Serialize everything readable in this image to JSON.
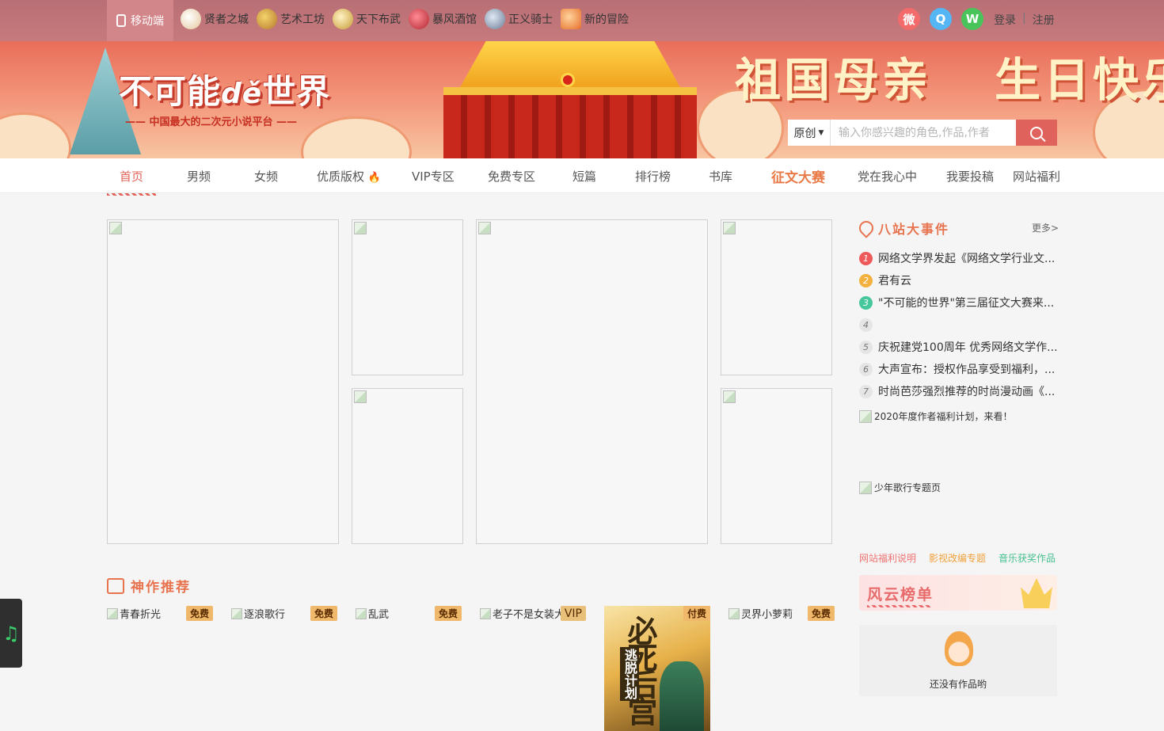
{
  "topbar": {
    "mobile_label": "移动端",
    "links": [
      {
        "label": "贤者之城",
        "icon": "scroll-icon"
      },
      {
        "label": "艺术工坊",
        "icon": "palette-icon"
      },
      {
        "label": "天下布武",
        "icon": "fan-icon"
      },
      {
        "label": "暴风酒馆",
        "icon": "wine-icon"
      },
      {
        "label": "正义骑士",
        "icon": "sword-icon"
      },
      {
        "label": "新的冒险",
        "icon": "mascot-icon"
      }
    ],
    "social": {
      "weibo": "微",
      "qq": "Q",
      "wechat": "W"
    },
    "login": "登录",
    "separator": "|",
    "register": "注册"
  },
  "banner": {
    "logo_main": "不可能",
    "logo_de": "dě",
    "logo_end": "世界",
    "slogan": "—— 中国最大的二次元小说平台 ——",
    "festival_a": "祖国母亲",
    "festival_b": "生日快乐"
  },
  "search": {
    "type_label": "原创",
    "placeholder": "输入你感兴趣的角色,作品,作者"
  },
  "nav": {
    "items": [
      "首页",
      "男频",
      "女频",
      "优质版权",
      "VIP专区",
      "免费专区",
      "短篇",
      "排行榜",
      "书库",
      "征文大赛",
      "党在我心中",
      "我要投稿",
      "网站福利"
    ],
    "hot_mark": "🔥"
  },
  "events": {
    "title": "八站大事件",
    "more": "更多>",
    "items": [
      {
        "num": "1",
        "text": "网络文学界发起《网络文学行业文..."
      },
      {
        "num": "2",
        "text": "君有云"
      },
      {
        "num": "3",
        "text": "\"不可能的世界\"第三届征文大赛来..."
      },
      {
        "num": "4",
        "text": ""
      },
      {
        "num": "5",
        "text": "庆祝建党100周年 优秀网络文学作..."
      },
      {
        "num": "6",
        "text": "大声宣布：授权作品享受到福利，..."
      },
      {
        "num": "7",
        "text": "时尚芭莎强烈推荐的时尚漫动画《..."
      }
    ],
    "promo_a": "2020年度作者福利计划，来看！",
    "promo_b": "少年歌行专题页"
  },
  "tags": {
    "a": "网站福利说明",
    "b": "影视改编专题",
    "c": "音乐获奖作品"
  },
  "rank": {
    "title": "风云榜单",
    "empty": "还没有作品哟"
  },
  "recommend": {
    "title": "神作推荐",
    "books": [
      {
        "title": "青春折光",
        "badge": "免费"
      },
      {
        "title": "逐浪歌行",
        "badge": "免费"
      },
      {
        "title": "乱武",
        "badge": "免费"
      },
      {
        "title": "老子不是女装大",
        "badge": "VIP"
      },
      {
        "title": "",
        "badge": "付费",
        "cover_title": "必死后宫",
        "cover_sub": "逃脱计划"
      },
      {
        "title": "灵界小萝莉",
        "badge": "免费"
      }
    ]
  },
  "music_icon": "♫"
}
